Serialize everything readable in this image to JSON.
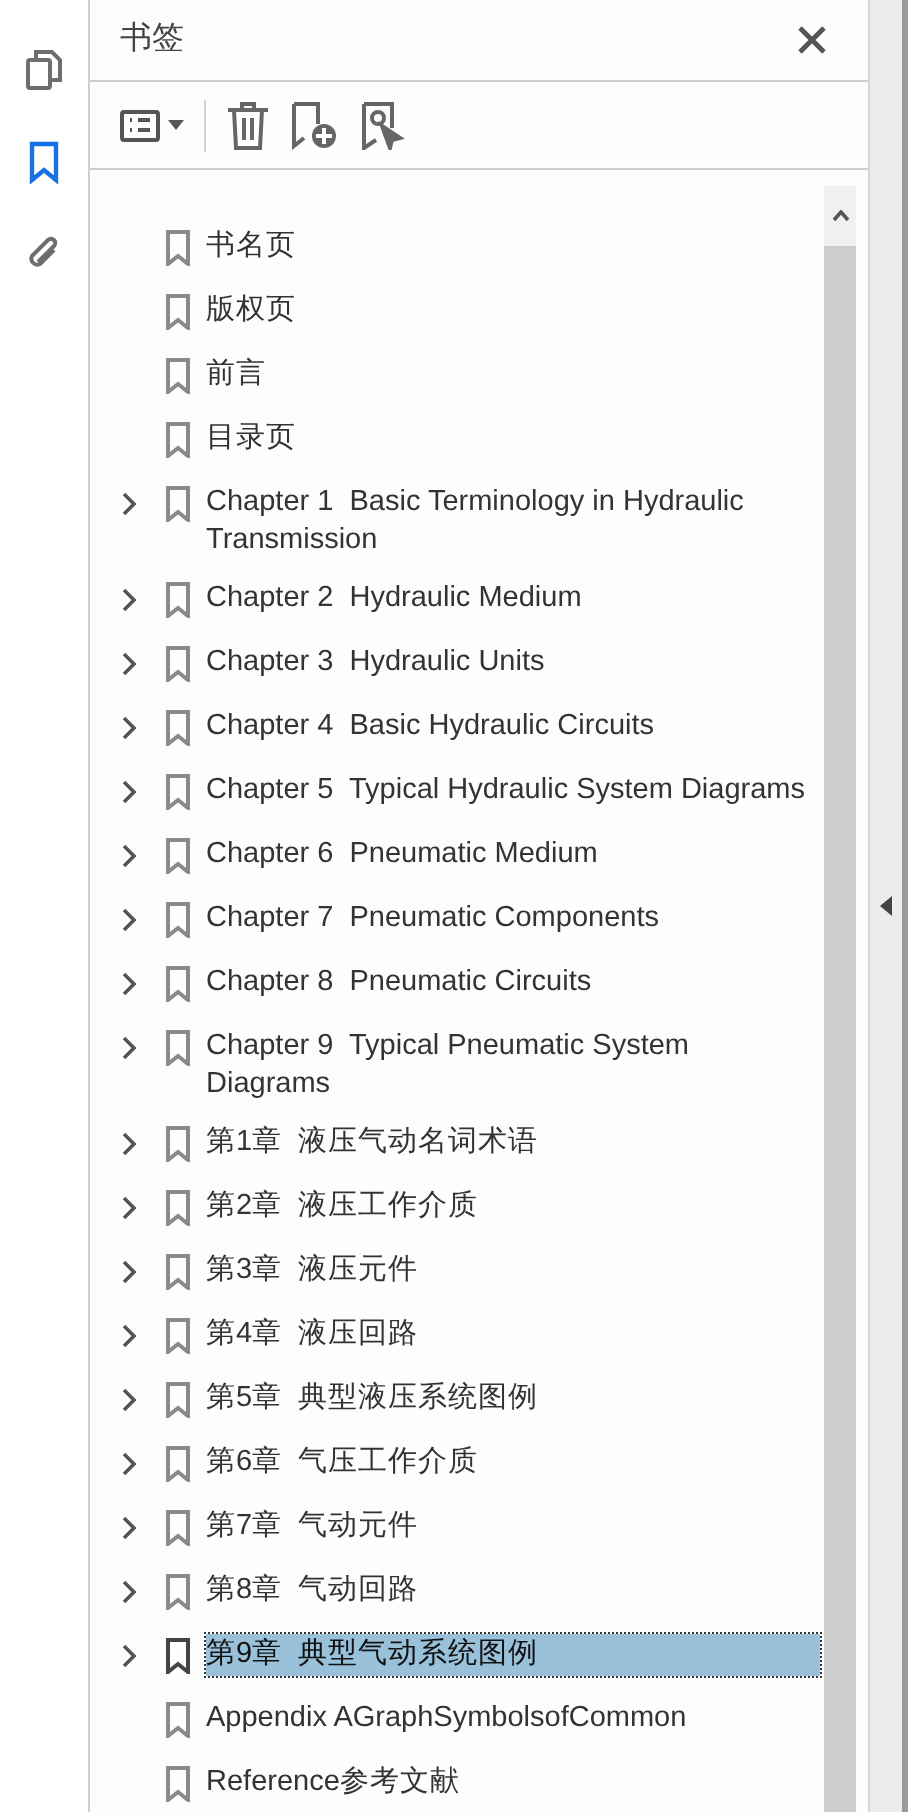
{
  "rail": [
    {
      "kind": "pages",
      "selected": false
    },
    {
      "kind": "bookmarks",
      "selected": true
    },
    {
      "kind": "attachments",
      "selected": false
    }
  ],
  "panel": {
    "title": "书签"
  },
  "bookmarks": [
    {
      "label": "书名页",
      "has_children": false,
      "selected": false
    },
    {
      "label": "版权页",
      "has_children": false,
      "selected": false
    },
    {
      "label": "前言",
      "has_children": false,
      "selected": false
    },
    {
      "label": "目录页",
      "has_children": false,
      "selected": false
    },
    {
      "label": "Chapter 1  Basic Terminology in Hydraulic Transmission",
      "has_children": true,
      "selected": false
    },
    {
      "label": "Chapter 2  Hydraulic Medium",
      "has_children": true,
      "selected": false
    },
    {
      "label": "Chapter 3  Hydraulic Units",
      "has_children": true,
      "selected": false
    },
    {
      "label": "Chapter 4  Basic Hydraulic Circuits",
      "has_children": true,
      "selected": false
    },
    {
      "label": "Chapter 5  Typical Hydraulic System Diagrams",
      "has_children": true,
      "selected": false
    },
    {
      "label": "Chapter 6  Pneumatic Medium",
      "has_children": true,
      "selected": false
    },
    {
      "label": "Chapter 7  Pneumatic Components",
      "has_children": true,
      "selected": false
    },
    {
      "label": "Chapter 8  Pneumatic Circuits",
      "has_children": true,
      "selected": false
    },
    {
      "label": "Chapter 9  Typical Pneumatic System Diagrams",
      "has_children": true,
      "selected": false
    },
    {
      "label": "第1章  液压气动名词术语",
      "has_children": true,
      "selected": false
    },
    {
      "label": "第2章  液压工作介质",
      "has_children": true,
      "selected": false
    },
    {
      "label": "第3章  液压元件",
      "has_children": true,
      "selected": false
    },
    {
      "label": "第4章  液压回路",
      "has_children": true,
      "selected": false
    },
    {
      "label": "第5章  典型液压系统图例",
      "has_children": true,
      "selected": false
    },
    {
      "label": "第6章  气压工作介质",
      "has_children": true,
      "selected": false
    },
    {
      "label": "第7章  气动元件",
      "has_children": true,
      "selected": false
    },
    {
      "label": "第8章  气动回路",
      "has_children": true,
      "selected": false
    },
    {
      "label": "第9章  典型气动系统图例",
      "has_children": true,
      "selected": true
    },
    {
      "label": "Appendix AGraphSymbolsofCommon",
      "has_children": false,
      "selected": false
    },
    {
      "label": "Reference参考文献",
      "has_children": false,
      "selected": false
    }
  ]
}
